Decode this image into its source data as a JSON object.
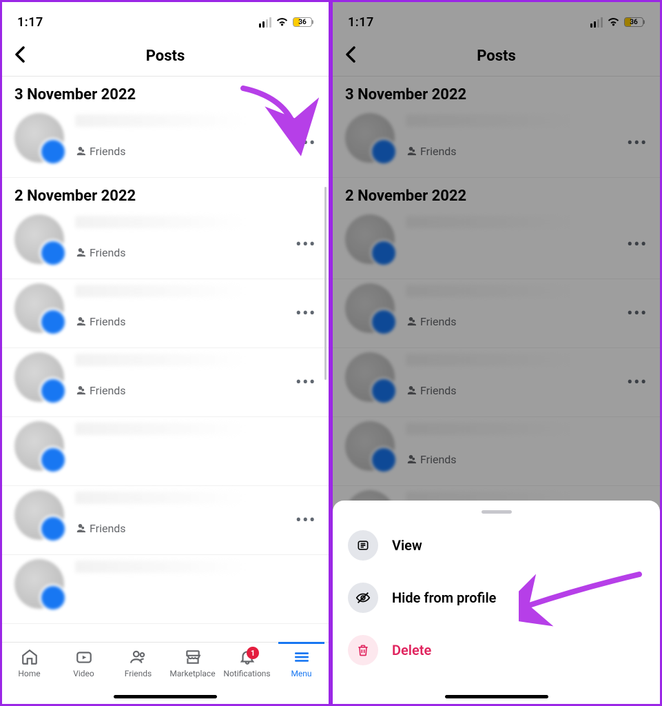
{
  "status": {
    "time": "1:17",
    "battery_percent": "36"
  },
  "header": {
    "title": "Posts"
  },
  "dates": {
    "d1": "3 November 2022",
    "d2": "2 November 2022"
  },
  "privacy_label": "Friends",
  "tabbar": {
    "home": "Home",
    "video": "Video",
    "friends": "Friends",
    "marketplace": "Marketplace",
    "notifications": "Notifications",
    "menu": "Menu",
    "notif_badge": "1"
  },
  "sheet": {
    "view": "View",
    "hide": "Hide from profile",
    "delete": "Delete"
  }
}
